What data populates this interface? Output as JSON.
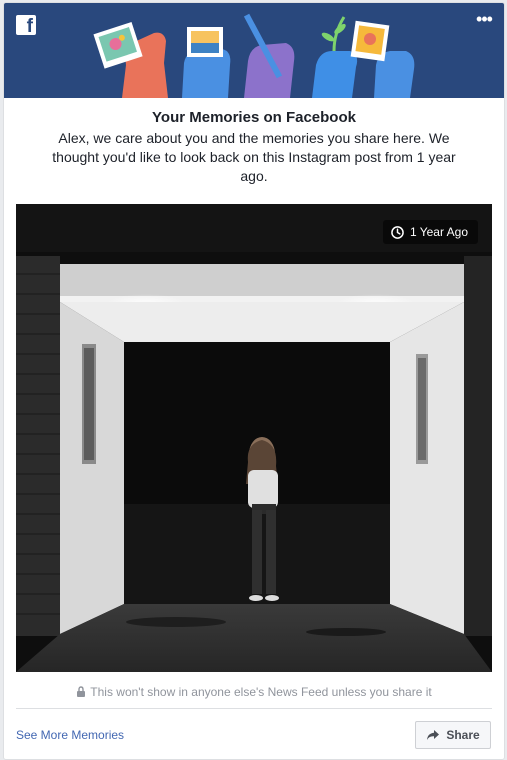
{
  "header": {
    "logo_letter": "f",
    "more_options_glyph": "•••"
  },
  "memory": {
    "title": "Your Memories on Facebook",
    "message": "Alex, we care about you and the memories you share here. We thought you'd like to look back on this Instagram post from 1 year ago.",
    "age_badge": "1 Year Ago",
    "privacy_note": "This won't show in anyone else's News Feed unless you share it"
  },
  "footer": {
    "see_more_label": "See More Memories",
    "share_label": "Share"
  },
  "icons": {
    "logo": "facebook-logo-icon",
    "more": "more-options-icon",
    "clock": "clock-icon",
    "lock": "lock-icon",
    "share": "share-arrow-icon"
  },
  "colors": {
    "banner": "#29487d",
    "link": "#4267b2",
    "muted_text": "#90949c",
    "body_text": "#1d2129"
  }
}
